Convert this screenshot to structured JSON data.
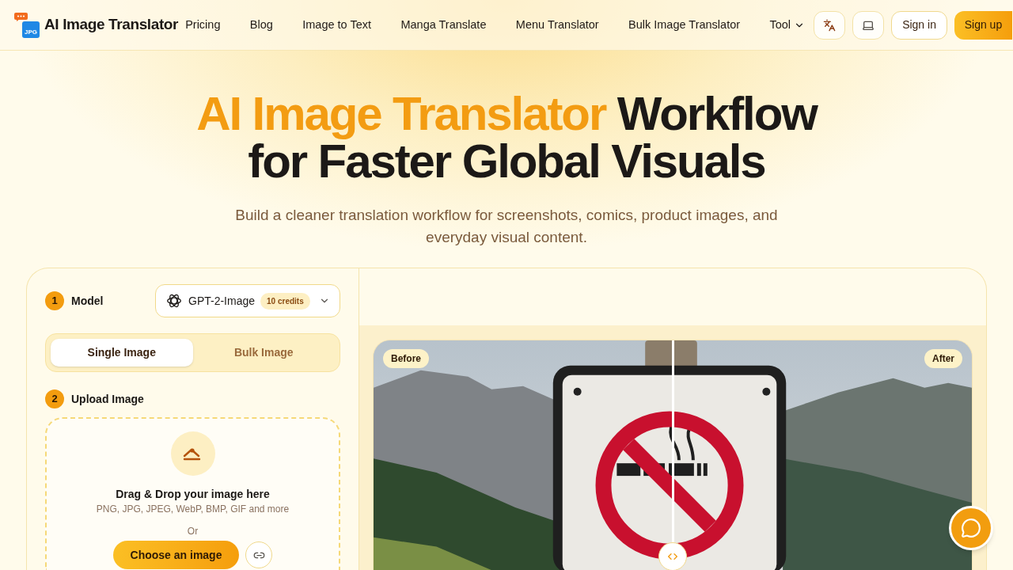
{
  "nav": {
    "logo": {
      "badge": "JPG",
      "name": "AI Image Translator"
    },
    "links": [
      "Pricing",
      "Blog",
      "Image to Text",
      "Manga Translate",
      "Menu Translator",
      "Bulk Image Translator"
    ],
    "dropdown": "Tool",
    "sign_in": "Sign in",
    "sign_up": "Sign up"
  },
  "hero": {
    "title_highlight": "AI Image Translator",
    "title_line_1_rest": "Workflow",
    "title_line_2": "for Faster Global Visuals",
    "subtitle": "Build a cleaner translation workflow for screenshots, comics, product images, and everyday visual content."
  },
  "model_step": {
    "number": "1",
    "label": "Model",
    "model": {
      "name": "GPT-2-Image",
      "credits": "10 credits"
    }
  },
  "mode_tabs": [
    {
      "label": "Single Image",
      "selected": true
    },
    {
      "label": "Bulk Image",
      "selected": false
    }
  ],
  "upload_step": {
    "number": "2",
    "label": "Upload Image",
    "drop_title": "Drag & Drop your image here",
    "formats": "PNG, JPG, JPEG, WebP, BMP, GIF and more",
    "separator": "Or",
    "button": "Choose an image"
  },
  "comparison": {
    "before_label": "Before",
    "after_label": "After",
    "level": 0.5
  }
}
